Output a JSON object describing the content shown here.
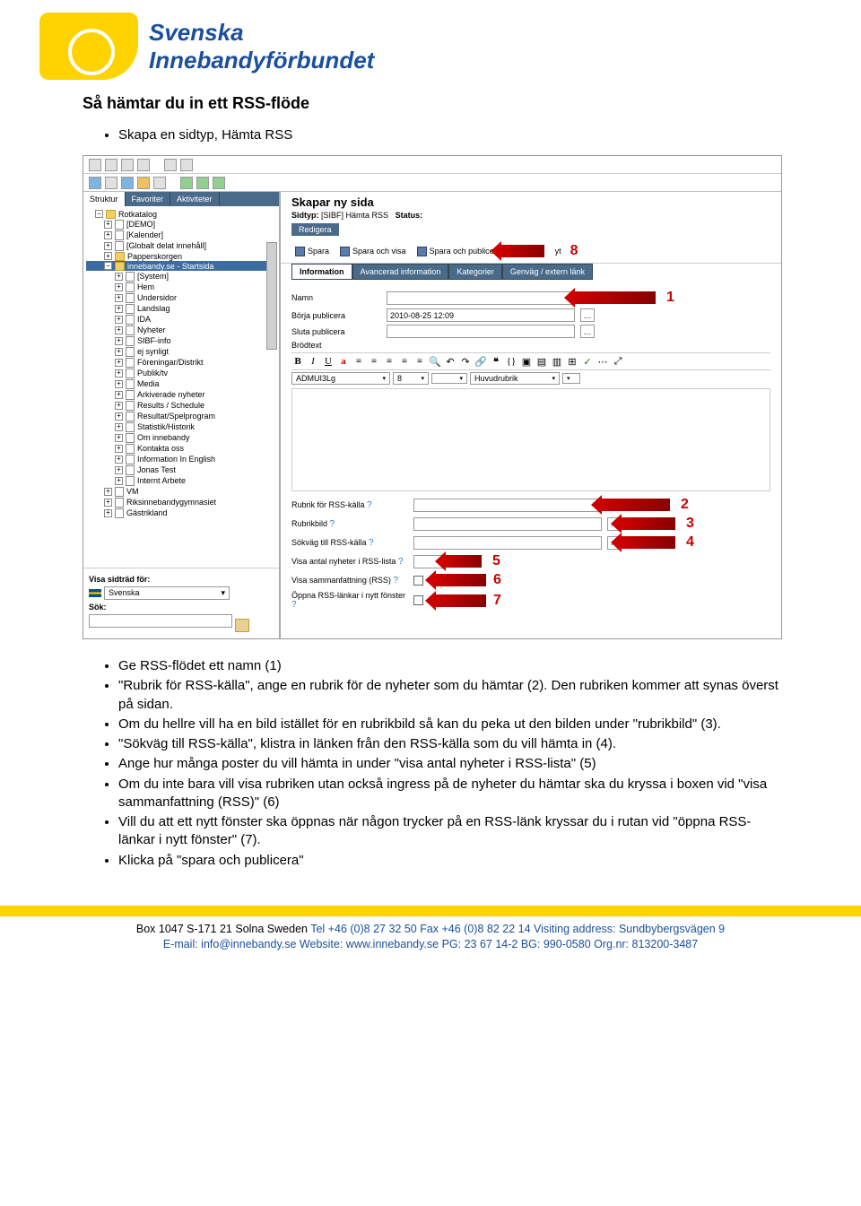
{
  "logo": {
    "line1": "Svenska",
    "line2": "Innebandyförbundet"
  },
  "heading": "Så hämtar du in ett RSS-flöde",
  "top_bullet": "Skapa en sidtyp, Hämta RSS",
  "screenshot": {
    "tabs": {
      "struktur": "Struktur",
      "favoriter": "Favoriter",
      "aktiviteter": "Aktiviteter"
    },
    "tree": {
      "root": "Rotkatalog",
      "items": [
        "[DEMO]",
        "[Kalender]",
        "[Globalt delat innehåll]",
        "Papperskorgen"
      ],
      "selected": "innebandy.se - Startsida",
      "children": [
        "[System]",
        "Hem",
        "Undersidor",
        "Landslag",
        "IDA",
        "Nyheter",
        "SIBF-info",
        "ej synligt",
        "Föreningar/Distrikt",
        "Publik/tv",
        "Media",
        "Arkiverade nyheter",
        "Results / Schedule",
        "Resultat/Spelprogram",
        "Statistik/Historik",
        "Om innebandy",
        "Kontakta oss",
        "Information In English",
        "Jonas Test",
        "Internt Arbete"
      ],
      "after": [
        "VM",
        "Riksinnebandygymnasiet",
        "Gästrikland"
      ]
    },
    "sidebar_bottom": {
      "visa_label": "Visa sidträd för:",
      "lang": "Svenska",
      "sok_label": "Sök:"
    },
    "page_title": "Skapar ny sida",
    "page_sub_prefix": "Sidtyp:",
    "page_sub_value": "[SIBF] Hämta RSS",
    "status_label": "Status:",
    "redigera": "Redigera",
    "actions": {
      "spara": "Spara",
      "spara_visa": "Spara och visa",
      "spara_pub": "Spara och publicera",
      "avbryt": "yt"
    },
    "infotabs": {
      "info": "Information",
      "avancerad": "Avancerad information",
      "kategorier": "Kategorier",
      "genvag": "Genväg / extern länk"
    },
    "form": {
      "namn": "Namn",
      "borja": "Börja publicera",
      "borja_value": "2010-08-25 12:09",
      "sluta": "Sluta publicera",
      "brodtext": "Brödtext",
      "font": "ADMUI3Lg",
      "size": "8",
      "style": "Huvudrubrik",
      "rubrik_kalla": "Rubrik för RSS-källa",
      "rubrikbild": "Rubrikbild",
      "sokvag": "Sökväg till RSS-källa",
      "visa_antal": "Visa antal nyheter i RSS-lista",
      "visa_samm": "Visa sammanfattning (RSS)",
      "oppna": "Öppna RSS-länkar i nytt fönster"
    },
    "arrows": {
      "n1": "1",
      "n2": "2",
      "n3": "3",
      "n4": "4",
      "n5": "5",
      "n6": "6",
      "n7": "7",
      "n8": "8"
    }
  },
  "instructions": {
    "i1": "Ge RSS-flödet ett namn (1)",
    "i2": "\"Rubrik för RSS-källa\", ange en rubrik för de nyheter som du hämtar (2). Den rubriken kommer att synas överst på sidan.",
    "i3": "Om du hellre vill ha en bild istället för en rubrikbild så kan du peka ut den bilden under \"rubrikbild\" (3).",
    "i4": "\"Sökväg till RSS-källa\", klistra in länken från den RSS-källa som du vill hämta in (4).",
    "i5": "Ange hur många poster du vill hämta in under \"visa antal nyheter i RSS-lista\" (5)",
    "i6": "Om du inte bara vill visa rubriken utan också ingress på de nyheter du hämtar ska du kryssa i boxen vid \"visa sammanfattning (RSS)\" (6)",
    "i7": "Vill du att ett nytt fönster ska öppnas när någon trycker på en RSS-länk kryssar du i rutan vid \"öppna RSS-länkar i nytt fönster\" (7).",
    "i8": "Klicka på \"spara och publicera\""
  },
  "footer": {
    "line1a": "Box 1047 S-171 21 Solna Sweden",
    "line1b": "Tel +46 (0)8 27 32 50 Fax +46 (0)8 82 22 14 Visiting address: Sundbybergsvägen 9",
    "line2": "E-mail: info@innebandy.se Website: www.innebandy.se  PG: 23 67 14-2 BG: 990-0580 Org.nr: 813200-3487"
  }
}
